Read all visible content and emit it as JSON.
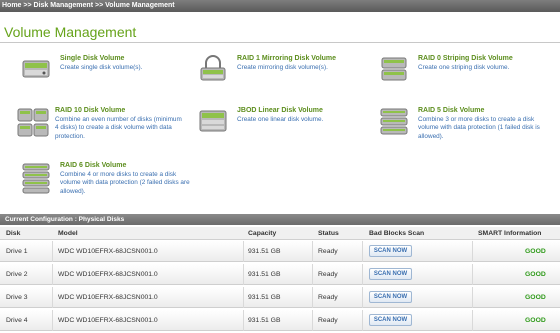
{
  "breadcrumb": "Home >> Disk Management >> Volume Management",
  "page_title": "Volume Management",
  "volume_options": [
    {
      "title": "Single Disk Volume",
      "desc": "Create single disk volume(s).",
      "icon": "single-disk-icon"
    },
    {
      "title": "RAID 1 Mirroring Disk Volume",
      "desc": "Create mirroring disk volume(s).",
      "icon": "raid1-mirror-icon"
    },
    {
      "title": "RAID 0 Striping Disk Volume",
      "desc": "Create one striping disk volume.",
      "icon": "raid0-stripe-icon"
    },
    {
      "title": "RAID 10 Disk Volume",
      "desc": "Combine an even number of disks (minimum 4 disks) to create a disk volume with data protection.",
      "icon": "raid10-icon"
    },
    {
      "title": "JBOD Linear Disk Volume",
      "desc": "Create one linear disk volume.",
      "icon": "jbod-linear-icon"
    },
    {
      "title": "RAID 5 Disk Volume",
      "desc": "Combine 3 or more disks to create a disk volume with data protection (1 failed disk is allowed).",
      "icon": "raid5-icon"
    },
    {
      "title": "RAID 6 Disk Volume",
      "desc": "Combine 4 or more disks to create a disk volume with data protection (2 failed disks are allowed).",
      "icon": "raid6-icon"
    }
  ],
  "config": {
    "header": "Current Configuration : Physical Disks",
    "columns": {
      "disk": "Disk",
      "model": "Model",
      "capacity": "Capacity",
      "status": "Status",
      "bad_blocks": "Bad Blocks Scan",
      "smart": "SMART Information"
    },
    "rows": [
      {
        "disk": "Drive 1",
        "model": "WDC WD10EFRX-68JCSN001.0",
        "capacity": "931.51 GB",
        "status": "Ready",
        "scan_label": "SCAN NOW",
        "smart": "GOOD"
      },
      {
        "disk": "Drive 2",
        "model": "WDC WD10EFRX-68JCSN001.0",
        "capacity": "931.51 GB",
        "status": "Ready",
        "scan_label": "SCAN NOW",
        "smart": "GOOD"
      },
      {
        "disk": "Drive 3",
        "model": "WDC WD10EFRX-68JCSN001.0",
        "capacity": "931.51 GB",
        "status": "Ready",
        "scan_label": "SCAN NOW",
        "smart": "GOOD"
      },
      {
        "disk": "Drive 4",
        "model": "WDC WD10EFRX-68JCSN001.0",
        "capacity": "931.51 GB",
        "status": "Ready",
        "scan_label": "SCAN NOW",
        "smart": "GOOD"
      }
    ]
  },
  "colors": {
    "title_green": "#66a31a",
    "option_title_green": "#5d8e1e",
    "link_blue": "#3a6fb0",
    "smart_good": "#2f9a1a"
  }
}
